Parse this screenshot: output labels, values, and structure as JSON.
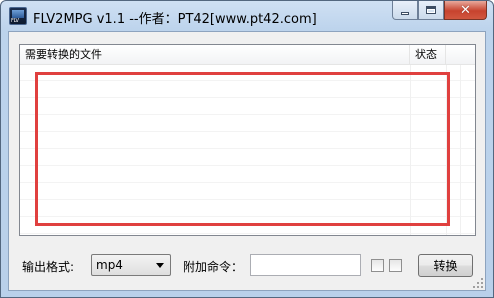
{
  "window": {
    "title": "FLV2MPG v1.1 --作者：PT42[www.pt42.com]",
    "icon": "flv-app-icon"
  },
  "caption_buttons": {
    "minimize_icon": "minimize-icon",
    "maximize_icon": "maximize-icon",
    "close_icon": "close-icon",
    "close_glyph": "✕"
  },
  "file_list": {
    "columns": [
      "需要转换的文件",
      "状态"
    ],
    "rows": []
  },
  "annotation": {
    "highlight_color": "#e0403f"
  },
  "options": {
    "format_label": "输出格式:",
    "format_value": "mp4",
    "extra_cmd_label": "附加命令：",
    "extra_cmd_value": "",
    "convert_button": "转换"
  }
}
